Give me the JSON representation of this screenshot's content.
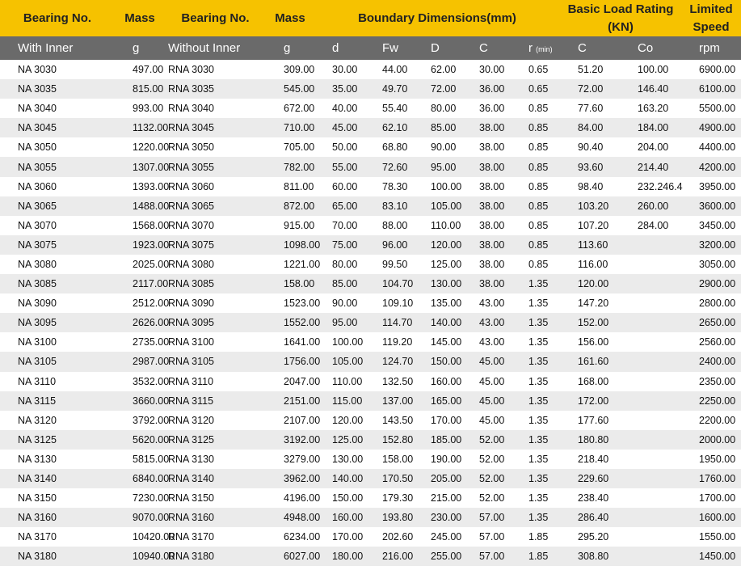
{
  "header": {
    "bearing_no_1": "Bearing No.",
    "mass_1": "Mass",
    "bearing_no_2": "Bearing No.",
    "mass_2": "Mass",
    "boundary": "Boundary Dimensions(mm)",
    "load_rating": "Basic Load Rating",
    "load_rating_unit": "(KN)",
    "limited": "Limited",
    "speed": "Speed"
  },
  "subheader": [
    "With Inner",
    "g",
    "Without Inner",
    "g",
    "d",
    "Fw",
    "D",
    "C",
    "r",
    "(min)",
    "C",
    "Co",
    "rpm"
  ],
  "rows": [
    [
      "NA 3030",
      "497.00",
      "RNA 3030",
      "309.00",
      "30.00",
      "44.00",
      "62.00",
      "30.00",
      "0.65",
      "51.20",
      "100.00",
      "6900.00"
    ],
    [
      "NA 3035",
      "815.00",
      "RNA 3035",
      "545.00",
      "35.00",
      "49.70",
      "72.00",
      "36.00",
      "0.65",
      "72.00",
      "146.40",
      "6100.00"
    ],
    [
      "NA 3040",
      "993.00",
      "RNA 3040",
      "672.00",
      "40.00",
      "55.40",
      "80.00",
      "36.00",
      "0.85",
      "77.60",
      "163.20",
      "5500.00"
    ],
    [
      "NA 3045",
      "1132.00",
      "RNA 3045",
      "710.00",
      "45.00",
      "62.10",
      "85.00",
      "38.00",
      "0.85",
      "84.00",
      "184.00",
      "4900.00"
    ],
    [
      "NA 3050",
      "1220.00",
      "RNA 3050",
      "705.00",
      "50.00",
      "68.80",
      "90.00",
      "38.00",
      "0.85",
      "90.40",
      "204.00",
      "4400.00"
    ],
    [
      "NA 3055",
      "1307.00",
      "RNA 3055",
      "782.00",
      "55.00",
      "72.60",
      "95.00",
      "38.00",
      "0.85",
      "93.60",
      "214.40",
      "4200.00"
    ],
    [
      "NA 3060",
      "1393.00",
      "RNA 3060",
      "811.00",
      "60.00",
      "78.30",
      "100.00",
      "38.00",
      "0.85",
      "98.40",
      "232.246.4",
      "3950.00"
    ],
    [
      "NA 3065",
      "1488.00",
      "RNA 3065",
      "872.00",
      "65.00",
      "83.10",
      "105.00",
      "38.00",
      "0.85",
      "103.20",
      "260.00",
      "3600.00"
    ],
    [
      "NA 3070",
      "1568.00",
      "RNA 3070",
      "915.00",
      "70.00",
      "88.00",
      "110.00",
      "38.00",
      "0.85",
      "107.20",
      "284.00",
      "3450.00"
    ],
    [
      "NA 3075",
      "1923.00",
      "RNA 3075",
      "1098.00",
      "75.00",
      "96.00",
      "120.00",
      "38.00",
      "0.85",
      "113.60",
      "",
      "3200.00"
    ],
    [
      "NA 3080",
      "2025.00",
      "RNA 3080",
      "1221.00",
      "80.00",
      "99.50",
      "125.00",
      "38.00",
      "0.85",
      "116.00",
      "",
      "3050.00"
    ],
    [
      "NA 3085",
      "2117.00",
      "RNA 3085",
      "158.00",
      "85.00",
      "104.70",
      "130.00",
      "38.00",
      "1.35",
      "120.00",
      "",
      "2900.00"
    ],
    [
      "NA 3090",
      "2512.00",
      "RNA 3090",
      "1523.00",
      "90.00",
      "109.10",
      "135.00",
      "43.00",
      "1.35",
      "147.20",
      "",
      "2800.00"
    ],
    [
      "NA 3095",
      "2626.00",
      "RNA 3095",
      "1552.00",
      "95.00",
      "114.70",
      "140.00",
      "43.00",
      "1.35",
      "152.00",
      "",
      "2650.00"
    ],
    [
      "NA 3100",
      "2735.00",
      "RNA 3100",
      "1641.00",
      "100.00",
      "119.20",
      "145.00",
      "43.00",
      "1.35",
      "156.00",
      "",
      "2560.00"
    ],
    [
      "NA 3105",
      "2987.00",
      "RNA 3105",
      "1756.00",
      "105.00",
      "124.70",
      "150.00",
      "45.00",
      "1.35",
      "161.60",
      "",
      "2400.00"
    ],
    [
      "NA 3110",
      "3532.00",
      "RNA 3110",
      "2047.00",
      "110.00",
      "132.50",
      "160.00",
      "45.00",
      "1.35",
      "168.00",
      "",
      "2350.00"
    ],
    [
      "NA 3115",
      "3660.00",
      "RNA 3115",
      "2151.00",
      "115.00",
      "137.00",
      "165.00",
      "45.00",
      "1.35",
      "172.00",
      "",
      "2250.00"
    ],
    [
      "NA 3120",
      "3792.00",
      "RNA 3120",
      "2107.00",
      "120.00",
      "143.50",
      "170.00",
      "45.00",
      "1.35",
      "177.60",
      "",
      "2200.00"
    ],
    [
      "NA 3125",
      "5620.00",
      "RNA 3125",
      "3192.00",
      "125.00",
      "152.80",
      "185.00",
      "52.00",
      "1.35",
      "180.80",
      "",
      "2000.00"
    ],
    [
      "NA 3130",
      "5815.00",
      "RNA 3130",
      "3279.00",
      "130.00",
      "158.00",
      "190.00",
      "52.00",
      "1.35",
      "218.40",
      "",
      "1950.00"
    ],
    [
      "NA 3140",
      "6840.00",
      "RNA 3140",
      "3962.00",
      "140.00",
      "170.50",
      "205.00",
      "52.00",
      "1.35",
      "229.60",
      "",
      "1760.00"
    ],
    [
      "NA 3150",
      "7230.00",
      "RNA 3150",
      "4196.00",
      "150.00",
      "179.30",
      "215.00",
      "52.00",
      "1.35",
      "238.40",
      "",
      "1700.00"
    ],
    [
      "NA 3160",
      "9070.00",
      "RNA 3160",
      "4948.00",
      "160.00",
      "193.80",
      "230.00",
      "57.00",
      "1.35",
      "286.40",
      "",
      "1600.00"
    ],
    [
      "NA 3170",
      "10420.00",
      "RNA 3170",
      "6234.00",
      "170.00",
      "202.60",
      "245.00",
      "57.00",
      "1.85",
      "295.20",
      "",
      "1550.00"
    ],
    [
      "NA 3180",
      "10940.00",
      "RNA 3180",
      "6027.00",
      "180.00",
      "216.00",
      "255.00",
      "57.00",
      "1.85",
      "308.80",
      "",
      "1450.00"
    ]
  ]
}
